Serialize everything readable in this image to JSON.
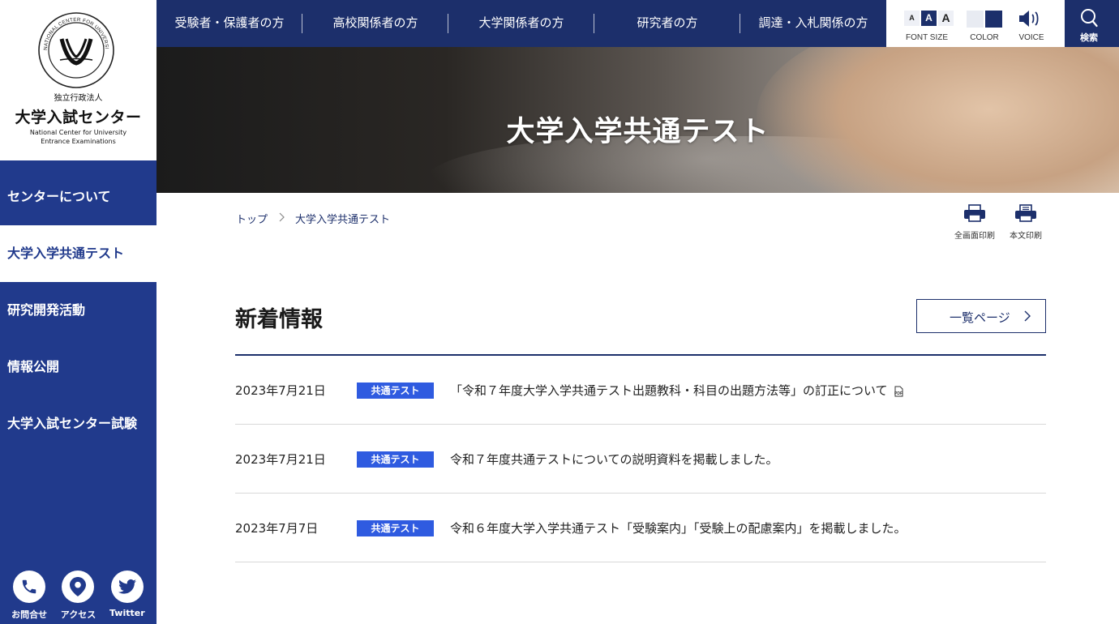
{
  "logo": {
    "seal_text": "NATIONAL CENTER FOR UNIVERSITY ENTRANCE EXAMINATIONS",
    "sub": "独立行政法人",
    "name": "大学入試センター",
    "en_line1": "National Center for University",
    "en_line2": "Entrance Examinations"
  },
  "sidebar": {
    "items": [
      {
        "label": "センターについて"
      },
      {
        "label": "大学入学共通テスト"
      },
      {
        "label": "研究開発活動"
      },
      {
        "label": "情報公開"
      },
      {
        "label": "大学入試センター試験"
      }
    ],
    "icons": [
      {
        "label": "お問合せ",
        "icon": "phone-icon"
      },
      {
        "label": "アクセス",
        "icon": "map-pin-icon"
      },
      {
        "label": "Twitter",
        "icon": "twitter-icon"
      }
    ]
  },
  "topnav": {
    "links": [
      {
        "label": "受験者・保護者の方"
      },
      {
        "label": "高校関係者の方"
      },
      {
        "label": "大学関係者の方"
      },
      {
        "label": "研究者の方"
      },
      {
        "label": "調達・入札関係の方"
      }
    ],
    "font_size_label": "FONT SIZE",
    "font_size_options": [
      "A",
      "A",
      "A"
    ],
    "color_label": "COLOR",
    "voice_label": "VOICE",
    "search_label": "検索"
  },
  "hero": {
    "title": "大学入学共通テスト"
  },
  "breadcrumb": {
    "home": "トップ",
    "current": "大学入学共通テスト"
  },
  "print": {
    "full": "全画面印刷",
    "body": "本文印刷"
  },
  "news": {
    "title": "新着情報",
    "more_label": "一覧ページ",
    "items": [
      {
        "date": "2023年7月21日",
        "tag": "共通テスト",
        "text": "「令和７年度大学入学共通テスト出題教科・科目の出題方法等」の訂正について"
      },
      {
        "date": "2023年7月21日",
        "tag": "共通テスト",
        "text": "令和７年度共通テストについての説明資料を掲載しました。"
      },
      {
        "date": "2023年7月7日",
        "tag": "共通テスト",
        "text": "令和６年度大学入学共通テスト「受験案内」「受験上の配慮案内」を掲載しました。"
      }
    ]
  },
  "colors": {
    "navy": "#1c2f6b",
    "sidebar_blue": "#213a8c",
    "tag_blue": "#2f5be0"
  }
}
